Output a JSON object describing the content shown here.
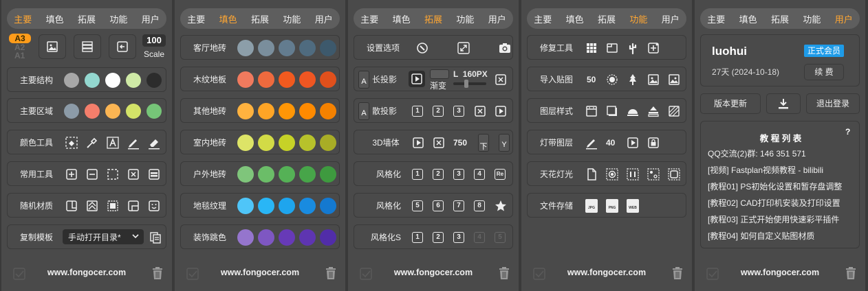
{
  "tabs": [
    "主要",
    "填色",
    "拓展",
    "功能",
    "用户"
  ],
  "footer_url": "www.fongocer.com",
  "colors": {
    "accent": "#ffa733",
    "vip_badge": "#1e9be8"
  },
  "p1": {
    "paper": {
      "a3": "A3",
      "a2": "A2",
      "a1": "A1"
    },
    "scale_value": "100",
    "scale_label": "Scale",
    "rows": {
      "structure": "主要结构",
      "area": "主要区域",
      "color_tool": "颜色工具",
      "common_tool": "常用工具",
      "random_mat": "随机材质",
      "copy_tpl": "复制模板"
    },
    "structure_colors": [
      "#a7a7a7",
      "#93d7cf",
      "#ffffff",
      "#cfeaa6",
      "#2c2c2c"
    ],
    "area_colors": [
      "#8c9ba8",
      "#f47e6b",
      "#fbb553",
      "#d3e368",
      "#76c578"
    ],
    "dropdown_value": "手动打开目录*"
  },
  "p2": {
    "rows": [
      {
        "label": "客厅地砖",
        "colors": [
          "#8c9ea9",
          "#7a8e9c",
          "#637c8f",
          "#4f6b7f",
          "#3d596c"
        ]
      },
      {
        "label": "木纹地板",
        "colors": [
          "#f07a5e",
          "#ee6a3e",
          "#f15a1f",
          "#ef5622",
          "#e0501c"
        ]
      },
      {
        "label": "其他地砖",
        "colors": [
          "#ffb23f",
          "#ffa526",
          "#ff9606",
          "#ff8a00",
          "#f48100"
        ]
      },
      {
        "label": "室内地砖",
        "colors": [
          "#dde467",
          "#d2db46",
          "#c6d227",
          "#b7c22b",
          "#a8ad26"
        ]
      },
      {
        "label": "户外地砖",
        "colors": [
          "#7fc57b",
          "#6bbd68",
          "#55b156",
          "#47a549",
          "#3e9a3f"
        ]
      },
      {
        "label": "地毯纹理",
        "colors": [
          "#4fc5f8",
          "#29b6f6",
          "#1ea5ee",
          "#198be0",
          "#1479d0"
        ]
      },
      {
        "label": "装饰跳色",
        "colors": [
          "#9575cd",
          "#7e57c2",
          "#673ab7",
          "#5e35b1",
          "#512da8"
        ]
      }
    ]
  },
  "p3": {
    "settings": "设置选项",
    "long_shadow": "长投影",
    "long_shadow_value": "L  160PX",
    "gradient": "渐变",
    "scatter_shadow": "散投影",
    "wall3d": "3D墙体",
    "wall_value": "750",
    "down": "下",
    "y": "Y",
    "a": "A",
    "stylize1": "风格化",
    "stylize2": "风格化",
    "stylizeS": "风格化S",
    "nums1": [
      "1",
      "2",
      "3"
    ],
    "nums2": [
      "1",
      "2",
      "3",
      "4"
    ],
    "nums3": [
      "5",
      "6",
      "7",
      "8"
    ],
    "nums4": [
      "1",
      "2",
      "3",
      "4",
      "5"
    ],
    "re": "Re"
  },
  "p4": {
    "repair": "修复工具",
    "import": "导入贴图",
    "import_value": "50",
    "layer_style": "图层样式",
    "light_layer": "灯带图层",
    "light_value": "40",
    "ceiling": "天花灯光",
    "file_save": "文件存储",
    "file_types": [
      "JPG",
      "PNG",
      "WEB"
    ]
  },
  "p5": {
    "username": "luohui",
    "vip": "正式会员",
    "days": "27天 (2024-10-18)",
    "renew": "续 费",
    "update": "版本更新",
    "logout": "退出登录",
    "tutorial_title": "教 程 列 表",
    "help": "?",
    "tutorials": [
      "QQ交流(2)群: 146 351 571",
      "[视频] Fastplan视频教程 - bilibili",
      "[教程01] PS初始化设置和暂存盘调整",
      "[教程02] CAD打印机安装及打印设置",
      "[教程03] 正式开始使用快速彩平插件",
      "[教程04] 如何自定义贴图材质"
    ]
  }
}
